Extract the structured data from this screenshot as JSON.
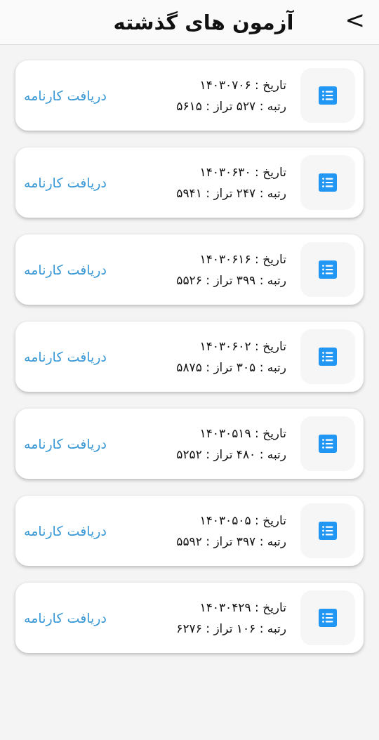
{
  "header": {
    "title": "آزمون های گذشته",
    "back": "<"
  },
  "exams": [
    {
      "date_line": "تاریخ : ۱۴۰۳۰۷۰۶",
      "result_line": "رتبه : ۵۲۷  تراز : ۵۶۱۵",
      "link": "دریافت کارنامه"
    },
    {
      "date_line": "تاریخ : ۱۴۰۳۰۶۳۰",
      "result_line": "رتبه : ۲۴۷  تراز : ۵۹۴۱",
      "link": "دریافت کارنامه"
    },
    {
      "date_line": "تاریخ : ۱۴۰۳۰۶۱۶",
      "result_line": "رتبه : ۳۹۹  تراز : ۵۵۲۶",
      "link": "دریافت کارنامه"
    },
    {
      "date_line": "تاریخ : ۱۴۰۳۰۶۰۲",
      "result_line": "رتبه : ۳۰۵  تراز : ۵۸۷۵",
      "link": "دریافت کارنامه"
    },
    {
      "date_line": "تاریخ : ۱۴۰۳۰۵۱۹",
      "result_line": "رتبه : ۴۸۰  تراز : ۵۲۵۲",
      "link": "دریافت کارنامه"
    },
    {
      "date_line": "تاریخ : ۱۴۰۳۰۵۰۵",
      "result_line": "رتبه : ۳۹۷  تراز : ۵۵۹۲",
      "link": "دریافت کارنامه"
    },
    {
      "date_line": "تاریخ : ۱۴۰۳۰۴۲۹",
      "result_line": "رتبه : ۱۰۶  تراز : ۶۲۷۶",
      "link": "دریافت کارنامه"
    }
  ]
}
